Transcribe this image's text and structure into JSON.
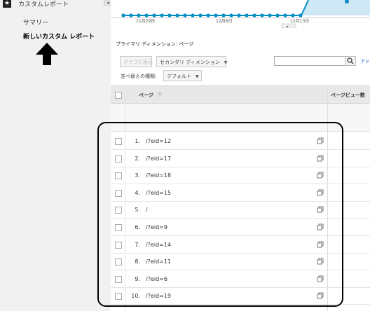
{
  "sidebar": {
    "header_title": "カスタムレポート",
    "items": [
      {
        "label": "サマリー",
        "active": false
      },
      {
        "label": "新しいカスタム レポート",
        "active": true
      }
    ]
  },
  "timeline": {
    "dates": [
      "11月29日",
      "12月6日",
      "12月13日"
    ]
  },
  "toolbar": {
    "primary_dimension_label": "プライマリ ディメンション:",
    "primary_dimension_value": "ページ",
    "chart_button": "グラフに表示",
    "secondary_dimension": "セカンダリ ディメンション",
    "sort_label": "並べ替えの種類:",
    "sort_value": "デフォルト",
    "search_placeholder": "",
    "advanced_link": "アド"
  },
  "table": {
    "columns": [
      "ページ",
      "ページビュー数"
    ],
    "rows": [
      {
        "index": "1.",
        "page": "/?eid=12"
      },
      {
        "index": "2.",
        "page": "/?eid=17"
      },
      {
        "index": "3.",
        "page": "/?eid=18"
      },
      {
        "index": "4.",
        "page": "/?eid=15"
      },
      {
        "index": "5.",
        "page": "/"
      },
      {
        "index": "6.",
        "page": "/?eid=9"
      },
      {
        "index": "7.",
        "page": "/?eid=14"
      },
      {
        "index": "8.",
        "page": "/?eid=11"
      },
      {
        "index": "9.",
        "page": "/?eid=6"
      },
      {
        "index": "10.",
        "page": "/?eid=19"
      }
    ]
  },
  "colors": {
    "line_series": "#058dc7",
    "area_fill": "#cfe8f6",
    "link": "#1155cc"
  }
}
